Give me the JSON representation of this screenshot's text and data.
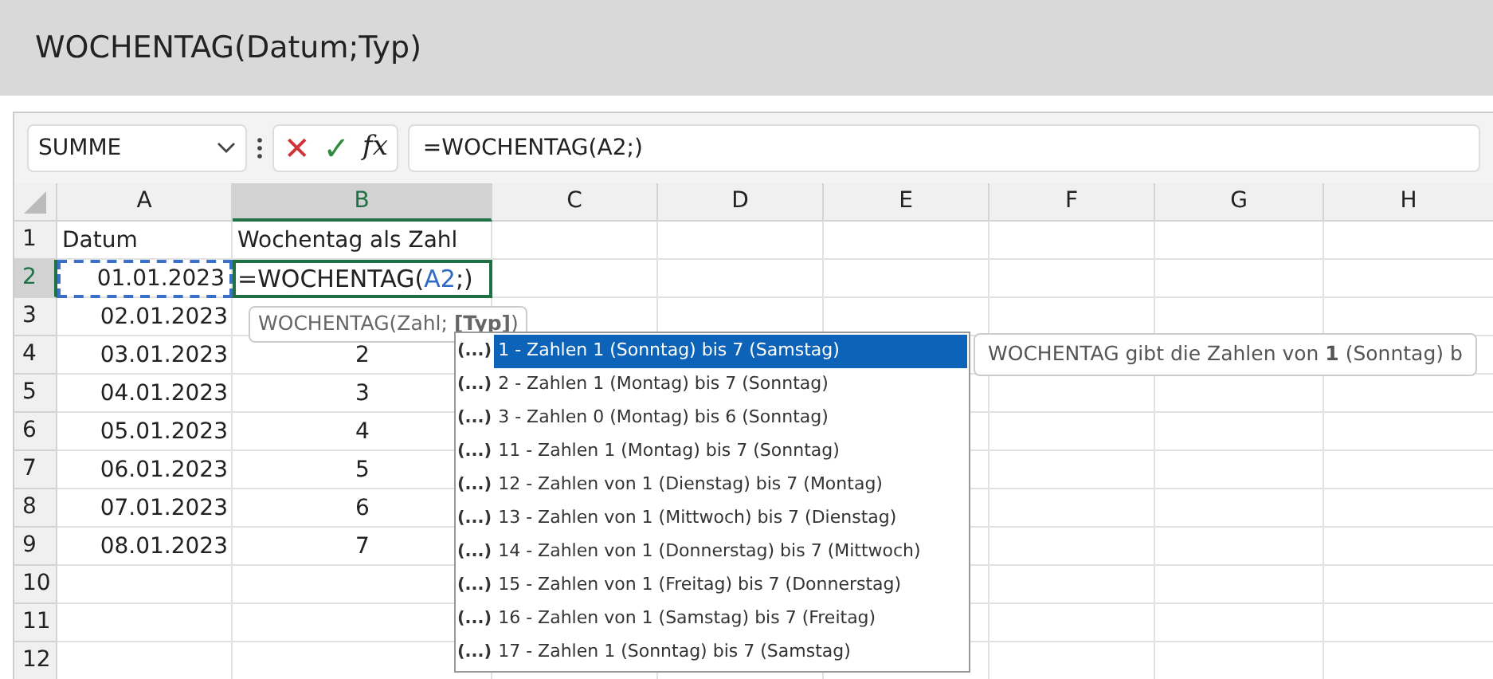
{
  "title": "WOCHENTAG(Datum;Typ)",
  "formula_bar": {
    "name_box": "SUMME",
    "cancel_glyph": "✕",
    "enter_glyph": "✓",
    "function_glyph": "fx",
    "formula": "=WOCHENTAG(A2;)"
  },
  "columns": [
    {
      "label": "A",
      "selected": false
    },
    {
      "label": "B",
      "selected": true
    },
    {
      "label": "C",
      "selected": false
    },
    {
      "label": "D",
      "selected": false
    },
    {
      "label": "E",
      "selected": false
    },
    {
      "label": "F",
      "selected": false
    },
    {
      "label": "G",
      "selected": false
    },
    {
      "label": "H",
      "selected": false
    }
  ],
  "rows": [
    {
      "number": "1",
      "selected": false,
      "cells": [
        {
          "text": "Datum",
          "kind": "text"
        },
        {
          "text": "Wochentag als Zahl",
          "kind": "text"
        }
      ]
    },
    {
      "number": "2",
      "selected": true,
      "cells": [
        {
          "text": "01.01.2023",
          "kind": "reference"
        },
        {
          "kind": "editing",
          "parts": [
            {
              "text": "=WOCHENTAG(",
              "kind": "plain"
            },
            {
              "text": "A2",
              "kind": "reference"
            },
            {
              "text": ";)",
              "kind": "plain"
            }
          ]
        }
      ]
    },
    {
      "number": "3",
      "selected": false,
      "cells": [
        {
          "text": "02.01.2023",
          "kind": "date"
        }
      ]
    },
    {
      "number": "4",
      "selected": false,
      "cells": [
        {
          "text": "03.01.2023",
          "kind": "date"
        },
        {
          "text": "2",
          "kind": "number"
        }
      ]
    },
    {
      "number": "5",
      "selected": false,
      "cells": [
        {
          "text": "04.01.2023",
          "kind": "date"
        },
        {
          "text": "3",
          "kind": "number"
        }
      ]
    },
    {
      "number": "6",
      "selected": false,
      "cells": [
        {
          "text": "05.01.2023",
          "kind": "date"
        },
        {
          "text": "4",
          "kind": "number"
        }
      ]
    },
    {
      "number": "7",
      "selected": false,
      "cells": [
        {
          "text": "06.01.2023",
          "kind": "date"
        },
        {
          "text": "5",
          "kind": "number"
        }
      ]
    },
    {
      "number": "8",
      "selected": false,
      "cells": [
        {
          "text": "07.01.2023",
          "kind": "date"
        },
        {
          "text": "6",
          "kind": "number"
        }
      ]
    },
    {
      "number": "9",
      "selected": false,
      "cells": [
        {
          "text": "08.01.2023",
          "kind": "date"
        },
        {
          "text": "7",
          "kind": "number"
        }
      ]
    },
    {
      "number": "10",
      "selected": false,
      "cells": []
    },
    {
      "number": "11",
      "selected": false,
      "cells": []
    },
    {
      "number": "12",
      "selected": false,
      "cells": []
    }
  ],
  "argument_tooltip": "WOCHENTAG(Zahl; **[Typ]**)",
  "autocomplete": [
    {
      "glyph": "(...)",
      "label": "1 - Zahlen 1 (Sonntag) bis 7 (Samstag)",
      "selected": true
    },
    {
      "glyph": "(...)",
      "label": "2 - Zahlen 1 (Montag) bis 7 (Sonntag)",
      "selected": false
    },
    {
      "glyph": "(...)",
      "label": "3 - Zahlen 0 (Montag) bis 6 (Sonntag)",
      "selected": false
    },
    {
      "glyph": "(...)",
      "label": "11 - Zahlen 1 (Montag) bis 7 (Sonntag)",
      "selected": false
    },
    {
      "glyph": "(...)",
      "label": "12 - Zahlen von 1 (Dienstag) bis 7 (Montag)",
      "selected": false
    },
    {
      "glyph": "(...)",
      "label": "13 - Zahlen von 1 (Mittwoch) bis 7 (Dienstag)",
      "selected": false
    },
    {
      "glyph": "(...)",
      "label": "14 - Zahlen von 1 (Donnerstag) bis 7 (Mittwoch)",
      "selected": false
    },
    {
      "glyph": "(...)",
      "label": "15 - Zahlen von 1 (Freitag) bis 7 (Donnerstag)",
      "selected": false
    },
    {
      "glyph": "(...)",
      "label": "16 - Zahlen von 1 (Samstag) bis 7 (Freitag)",
      "selected": false
    },
    {
      "glyph": "(...)",
      "label": "17 - Zahlen 1 (Sonntag) bis 7 (Samstag)",
      "selected": false
    }
  ],
  "description_tooltip": "WOCHENTAG gibt die Zahlen von **1** (Sonntag) b"
}
